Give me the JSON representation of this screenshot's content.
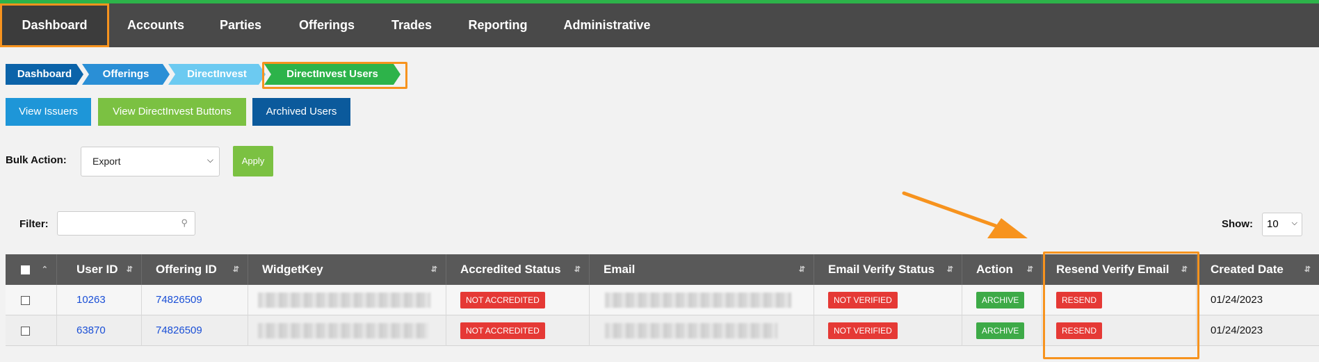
{
  "colors": {
    "nav_bg": "#494949",
    "accent_green": "#2db34a",
    "highlight_orange": "#f7931e",
    "crumb_dark_blue": "#0b63a9",
    "crumb_blue": "#2a8fd6",
    "crumb_light_blue": "#6ccaf1",
    "crumb_green": "#2db34a",
    "badge_red": "#e53935",
    "badge_green": "#3daa47",
    "link_blue": "#1a4fd6"
  },
  "nav": {
    "items": [
      {
        "label": "Dashboard",
        "active": true
      },
      {
        "label": "Accounts"
      },
      {
        "label": "Parties"
      },
      {
        "label": "Offerings"
      },
      {
        "label": "Trades"
      },
      {
        "label": "Reporting"
      },
      {
        "label": "Administrative"
      }
    ]
  },
  "breadcrumb": [
    {
      "label": "Dashboard"
    },
    {
      "label": "Offerings"
    },
    {
      "label": "DirectInvest"
    },
    {
      "label": "DirectInvest Users"
    }
  ],
  "buttons": {
    "view_issuers": "View Issuers",
    "view_directinvest_buttons": "View DirectInvest Buttons",
    "archived_users": "Archived Users"
  },
  "bulk": {
    "label": "Bulk Action:",
    "selected": "Export",
    "apply": "Apply"
  },
  "filter": {
    "label": "Filter:",
    "value": ""
  },
  "show": {
    "label": "Show:",
    "selected": "10"
  },
  "table": {
    "columns": [
      "User ID",
      "Offering ID",
      "WidgetKey",
      "Accredited Status",
      "Email",
      "Email Verify Status",
      "Action",
      "Resend Verify Email",
      "Created Date"
    ],
    "rows": [
      {
        "user_id": "10263",
        "offering_id": "74826509",
        "accredited": "NOT ACCREDITED",
        "verify": "NOT VERIFIED",
        "action": "ARCHIVE",
        "resend": "RESEND",
        "created": "01/24/2023"
      },
      {
        "user_id": "63870",
        "offering_id": "74826509",
        "accredited": "NOT ACCREDITED",
        "verify": "NOT VERIFIED",
        "action": "ARCHIVE",
        "resend": "RESEND",
        "created": "01/24/2023"
      }
    ]
  },
  "icons": {
    "search": "search-icon",
    "sort": "sort-icon",
    "dropdown": "chevron-down-icon",
    "annotation": "arrow-annotation-icon"
  }
}
